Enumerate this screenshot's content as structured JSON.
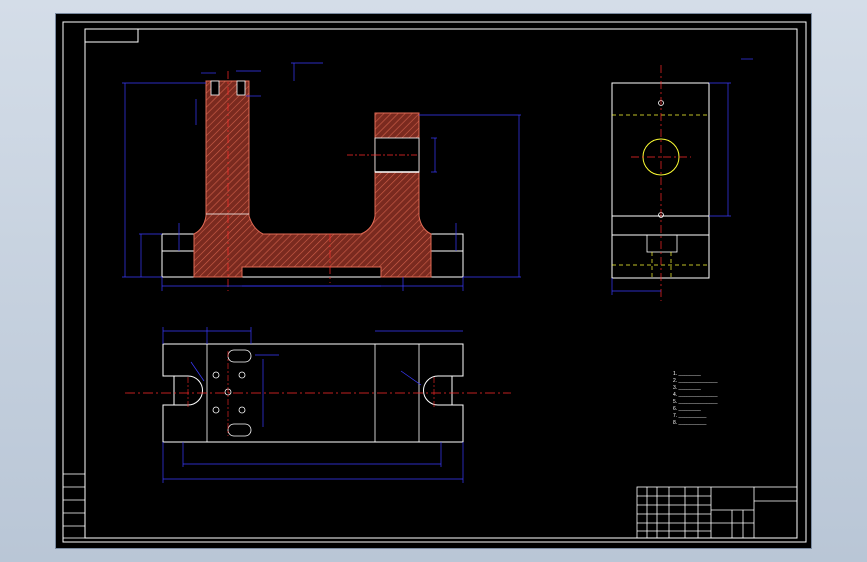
{
  "window": {
    "title": ""
  },
  "drawing": {
    "name": "",
    "colors": {
      "background": "#000000",
      "frame": "#ffffff",
      "dimension": "#3a3aff",
      "section": "#c84a3a",
      "hatch_fill": "#7a2a1f",
      "center": "#ff2a2a",
      "hidden": "#ffff33"
    },
    "notes": {
      "lines": [
        "1. ________",
        "2. ______________",
        "3. ________",
        "4. ______________",
        "5. ______________",
        "6. ________",
        "7. __________",
        "8. __________"
      ]
    },
    "title_block": {
      "part_name": "",
      "material": "",
      "scale": "",
      "sheet": ""
    }
  }
}
